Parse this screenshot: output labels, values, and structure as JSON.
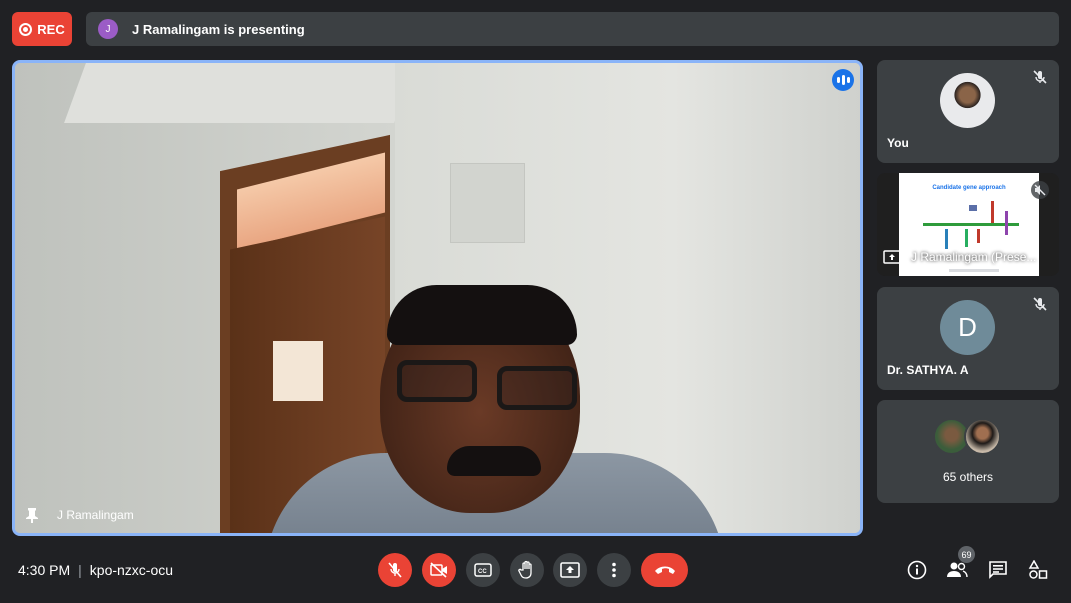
{
  "recording": {
    "label": "REC"
  },
  "presenting_bar": {
    "avatar_initial": "J",
    "text": "J Ramalingam is presenting"
  },
  "main_video": {
    "participant_name": "J Ramalingam"
  },
  "tiles": {
    "self": {
      "name": "You"
    },
    "presentation": {
      "name": "J Ramalingam (Prese...",
      "slide_title": "Candidate gene approach"
    },
    "sathya": {
      "initial": "D",
      "name": "Dr. SATHYA. A"
    },
    "others": {
      "label": "65 others"
    }
  },
  "bottom_bar": {
    "time": "4:30 PM",
    "separator": "|",
    "meeting_code": "kpo-nzxc-ocu",
    "participant_count": "69"
  },
  "colors": {
    "accent": "#8ab4f8",
    "danger": "#ea4335",
    "surface": "#3c4043",
    "background": "#202124"
  }
}
